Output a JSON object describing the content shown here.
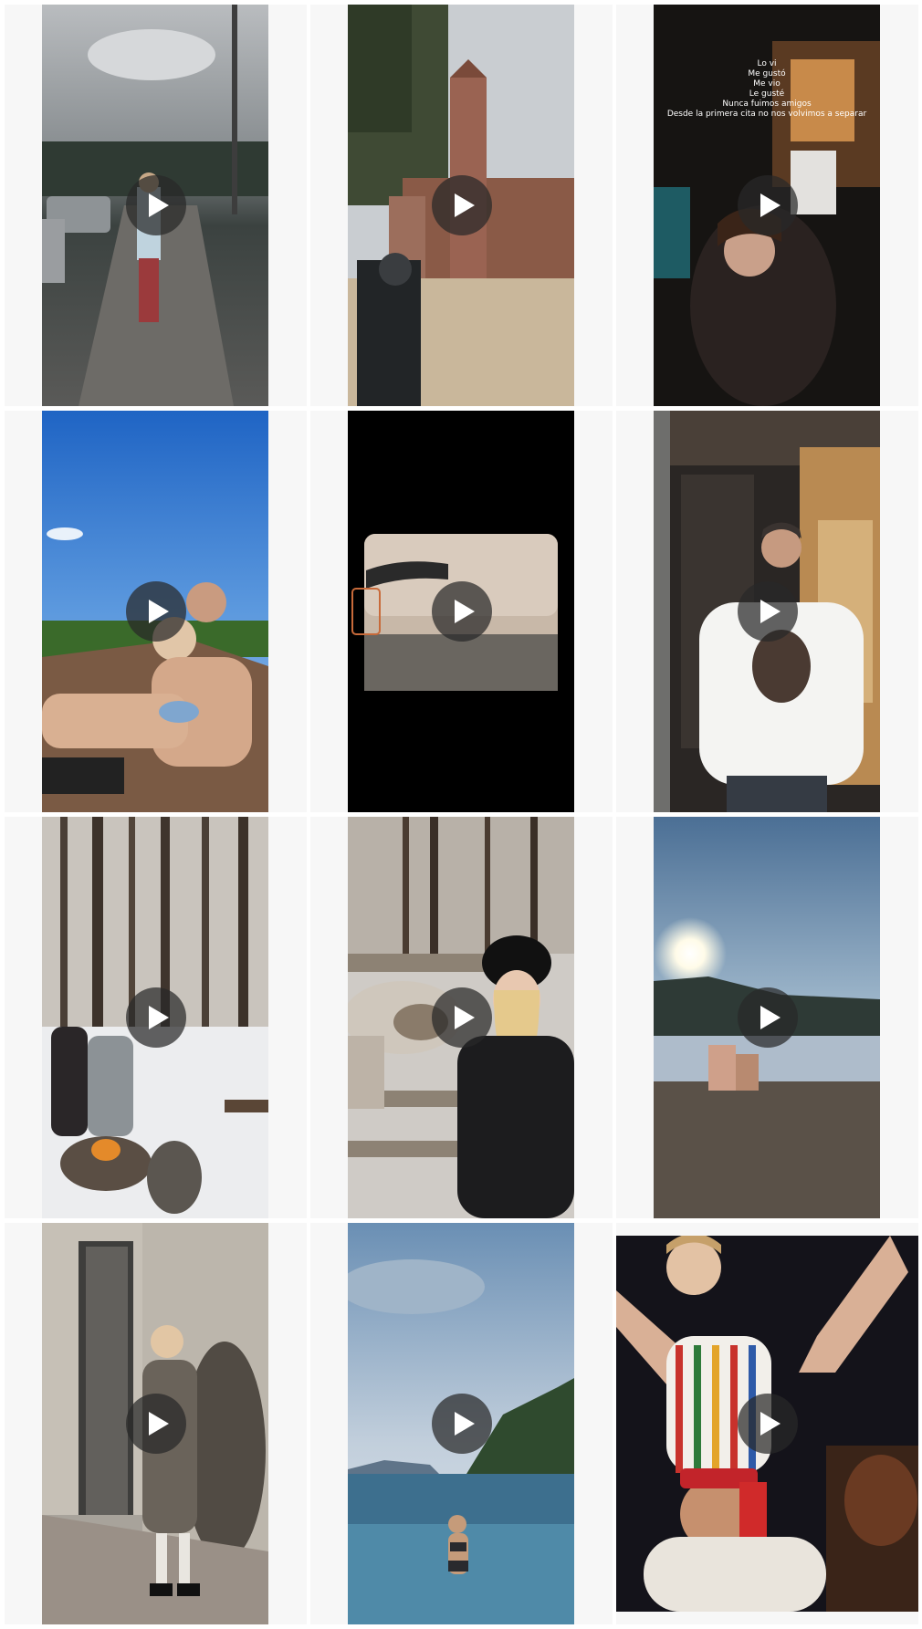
{
  "grid": {
    "items": [
      {
        "kind": "video",
        "scene": "street-woman-walking"
      },
      {
        "kind": "video",
        "scene": "castle-tower"
      },
      {
        "kind": "video",
        "scene": "nightclub-dance",
        "caption_lines": [
          "Lo vi",
          "Me gustó",
          "Me vio",
          "Le gusté",
          "Nunca fuimos amigos",
          "Desde la primera cita no nos volvimos a separar"
        ]
      },
      {
        "kind": "video",
        "scene": "couple-beach-sky"
      },
      {
        "kind": "video",
        "scene": "car-window-sunset"
      },
      {
        "kind": "video",
        "scene": "man-shop-door"
      },
      {
        "kind": "video",
        "scene": "snow-forest-campfire"
      },
      {
        "kind": "video",
        "scene": "reindeer-selfie"
      },
      {
        "kind": "video",
        "scene": "sunset-bay-rocks"
      },
      {
        "kind": "video",
        "scene": "woman-concrete-wall"
      },
      {
        "kind": "video",
        "scene": "sea-swimmer"
      },
      {
        "kind": "video",
        "scene": "party-shoulders"
      }
    ]
  },
  "icons": {
    "play": "play-icon"
  },
  "colors": {
    "play_bg": "#282828b8",
    "cell_bg": "#f7f7f7"
  }
}
